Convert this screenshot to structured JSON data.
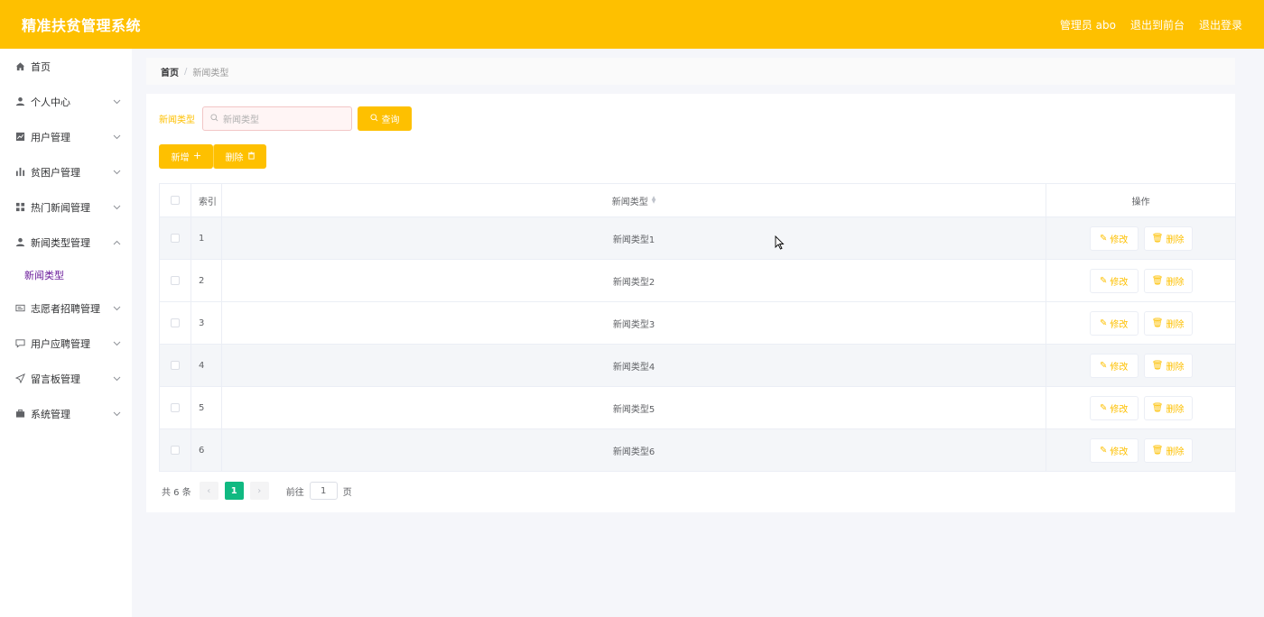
{
  "header": {
    "title": "精准扶贫管理系统",
    "admin_label": "管理员 abo",
    "back_front_label": "退出到前台",
    "logout_label": "退出登录"
  },
  "sidebar": {
    "items": [
      {
        "label": "首页",
        "icon": "home-icon",
        "has_arrow": false
      },
      {
        "label": "个人中心",
        "icon": "user-icon",
        "has_arrow": true
      },
      {
        "label": "用户管理",
        "icon": "chart-icon",
        "has_arrow": true
      },
      {
        "label": "贫困户管理",
        "icon": "bar-chart-icon",
        "has_arrow": true
      },
      {
        "label": "热门新闻管理",
        "icon": "grid-icon",
        "has_arrow": true
      },
      {
        "label": "新闻类型管理",
        "icon": "user-icon",
        "has_arrow": true,
        "expanded": true
      },
      {
        "label": "志愿者招聘管理",
        "icon": "card-icon",
        "has_arrow": true
      },
      {
        "label": "用户应聘管理",
        "icon": "message-icon",
        "has_arrow": true
      },
      {
        "label": "留言板管理",
        "icon": "send-icon",
        "has_arrow": true
      },
      {
        "label": "系统管理",
        "icon": "briefcase-icon",
        "has_arrow": true
      }
    ],
    "submenu": {
      "label": "新闻类型"
    }
  },
  "breadcrumb": {
    "home": "首页",
    "current": "新闻类型"
  },
  "search": {
    "label": "新闻类型",
    "placeholder": "新闻类型",
    "query_label": "查询"
  },
  "actions": {
    "add_label": "新增",
    "delete_label": "删除"
  },
  "table": {
    "headers": {
      "index": "索引",
      "name": "新闻类型",
      "ops": "操作"
    },
    "rows": [
      {
        "index": "1",
        "name": "新闻类型1"
      },
      {
        "index": "2",
        "name": "新闻类型2"
      },
      {
        "index": "3",
        "name": "新闻类型3"
      },
      {
        "index": "4",
        "name": "新闻类型4"
      },
      {
        "index": "5",
        "name": "新闻类型5"
      },
      {
        "index": "6",
        "name": "新闻类型6"
      }
    ],
    "edit_label": "修改",
    "delete_label": "删除"
  },
  "pager": {
    "total": "共 6 条",
    "current_page": "1",
    "goto_label": "前往",
    "goto_value": "1",
    "page_unit": "页"
  },
  "colors": {
    "accent": "#fec000",
    "active_page": "#10b981",
    "submenu_text": "#6a1b9a"
  }
}
